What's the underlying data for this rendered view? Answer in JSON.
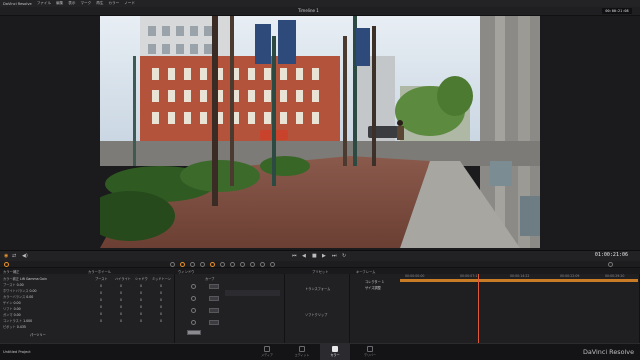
{
  "menubar": {
    "app_name": "DaVinci Resolve",
    "items": [
      "ファイル",
      "編集",
      "表示",
      "マーク",
      "再生",
      "カラー",
      "ノード"
    ]
  },
  "titlebar": {
    "timeline_name": "Timeline 1",
    "timecode": "00:00:21:08"
  },
  "transport": {
    "timecode": "01:00:21:06"
  },
  "viewer": {
    "description_icon": "street-photo-frame"
  },
  "panels": {
    "color_wheels": {
      "rows": [
        {
          "label": "カラー補正",
          "value": "Lift Gamma Gain"
        },
        {
          "label": "ブースト",
          "value": "0.00"
        },
        {
          "label": "ホワイトバランス",
          "value": "0.00"
        },
        {
          "label": "カラーバランス",
          "value": "0.00"
        },
        {
          "label": "ゲイン",
          "value": "0.00"
        },
        {
          "label": "リフト",
          "value": "0.00"
        },
        {
          "label": "ガンマ",
          "value": "0.00"
        },
        {
          "label": "コントラスト",
          "value": "1.000"
        },
        {
          "label": "ピボット",
          "value": "0.435"
        }
      ],
      "columns": [
        "ブースト",
        "ハイライト",
        "シャドウ",
        "ミッドトーン"
      ],
      "grid": [
        [
          "0",
          "0",
          "0",
          "0"
        ],
        [
          "0",
          "0",
          "0",
          "0"
        ],
        [
          "0",
          "0",
          "0",
          "0"
        ],
        [
          "0",
          "0",
          "0",
          "0"
        ],
        [
          "0",
          "0",
          "0",
          "0"
        ],
        [
          "0",
          "0",
          "0",
          "0"
        ]
      ],
      "footer": "パーツリー"
    },
    "curves": {
      "title": "カーブ"
    },
    "preset": {
      "title": "プリセット",
      "items": [
        "トランスフォーム",
        "ソフトクリップ"
      ]
    },
    "keyframes": {
      "title": "キーフレーム",
      "tracks": [
        "コレクター 1",
        "サイズ調整"
      ],
      "ruler": [
        "00:00:00:00",
        "00:00:07:11",
        "00:00:14:22",
        "00:00:22:09",
        "00:00:29:20"
      ]
    }
  },
  "headers": {
    "left": "カラー補正",
    "color_wheel_title": "カラーホイール",
    "curves_title": "ウィンドウ",
    "preset_title": "プリセット",
    "keys_title": "キーフレーム"
  },
  "statusbar": {
    "project": "Untitled Project",
    "brand": "DaVinci Resolve",
    "pages": [
      {
        "label": "メディア",
        "active": false
      },
      {
        "label": "エディット",
        "active": false
      },
      {
        "label": "カラー",
        "active": true
      },
      {
        "label": "デリバー",
        "active": false
      }
    ]
  },
  "colors": {
    "accent": "#e8912a",
    "bg": "#1c1c1e"
  }
}
